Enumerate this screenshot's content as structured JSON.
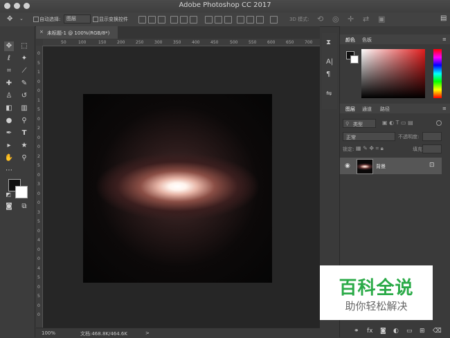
{
  "window": {
    "title": "Adobe Photoshop CC 2017"
  },
  "options_bar": {
    "auto_select_label": "自动选择:",
    "auto_select_value": "图层",
    "show_transform_label": "显示变换控件",
    "mode_3d_label": "3D 模式:"
  },
  "document": {
    "tab_title": "未标题-1 @ 100%(RGB/8*)",
    "close_glyph": "×"
  },
  "rulers": {
    "top": [
      "50",
      "100",
      "150",
      "200",
      "250",
      "300",
      "350",
      "400",
      "450",
      "500",
      "550",
      "600",
      "650",
      "700"
    ],
    "left": [
      "0",
      "5",
      "1",
      "0",
      "0",
      "1",
      "5",
      "0",
      "2",
      "0",
      "0",
      "2",
      "5",
      "0",
      "3",
      "0",
      "0",
      "3",
      "5",
      "0",
      "4",
      "0",
      "0",
      "4",
      "5",
      "0",
      "5",
      "0",
      "0"
    ]
  },
  "status": {
    "zoom": "100%",
    "doc_info": "文档:468.8K/464.6K",
    "arrow": ">"
  },
  "color_panel": {
    "tabs": [
      "颜色",
      "色板"
    ],
    "foreground": "#111111",
    "background": "#ffffff"
  },
  "layers_panel": {
    "tabs": [
      "图层",
      "通道",
      "路径"
    ],
    "kind_placeholder": "类型",
    "blend_mode": "正常",
    "opacity_label": "不透明度:",
    "lock_label": "锁定:",
    "fill_label": "填充:",
    "layer_name": "背景"
  },
  "bottom_icons": [
    "link-icon",
    "fx-icon",
    "mask-icon",
    "adjustment-icon",
    "folder-icon",
    "new-layer-icon",
    "trash-icon"
  ],
  "watermark": {
    "title": "百科全说",
    "subtitle": "助你轻松解决"
  },
  "colors": {
    "accent_green": "#2aaa47",
    "panel_bg": "#3a3a3a",
    "workspace": "#262626"
  }
}
